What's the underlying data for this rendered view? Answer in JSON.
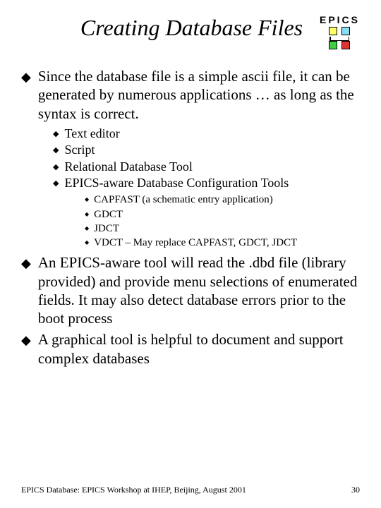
{
  "logo_text": "EPICS",
  "title": "Creating Database Files",
  "bullets": {
    "b1": "Since the database file is a simple ascii file, it can be generated by numerous applications … as long as the syntax is correct.",
    "b1_1": "Text editor",
    "b1_2": "Script",
    "b1_3": "Relational Database Tool",
    "b1_4": "EPICS-aware Database Configuration Tools",
    "b1_4_1": "CAPFAST (a schematic entry application)",
    "b1_4_2": "GDCT",
    "b1_4_3": "JDCT",
    "b1_4_4": "VDCT – May replace CAPFAST, GDCT, JDCT",
    "b2": "An EPICS-aware tool will read the .dbd file (library provided) and provide menu selections of enumerated fields. It may also detect database errors prior to the boot process",
    "b3": "A graphical tool is helpful to document and support complex databases"
  },
  "footer_left": "EPICS Database: EPICS Workshop at IHEP, Beijing, August 2001",
  "footer_right": "30"
}
